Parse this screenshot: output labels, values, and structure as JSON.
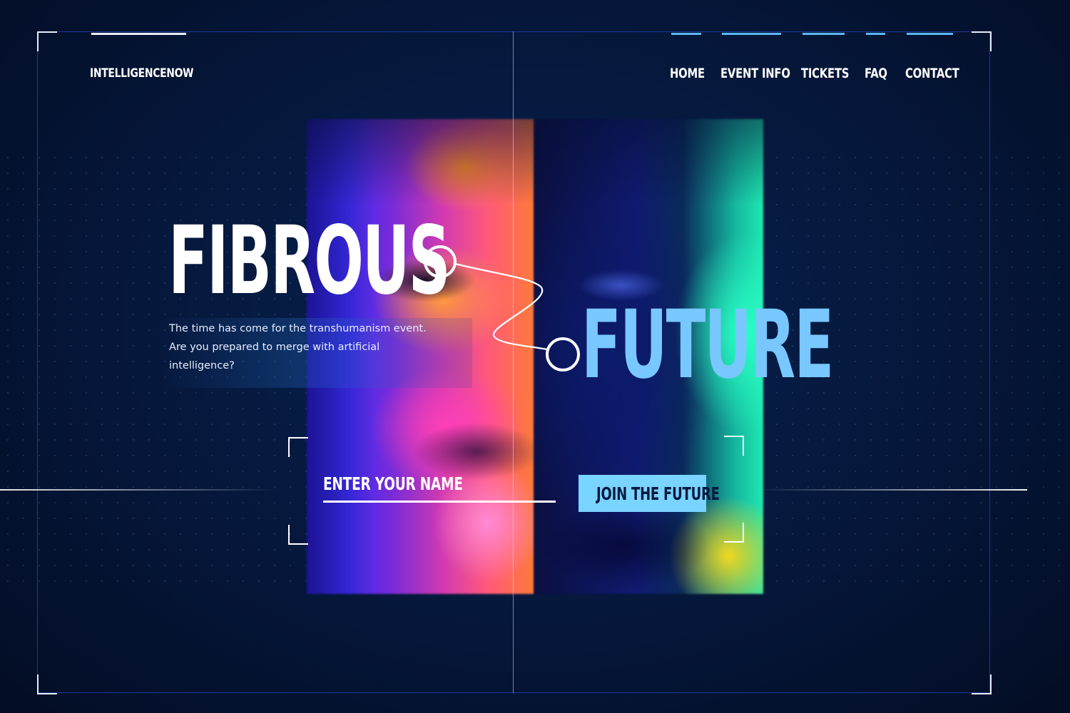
{
  "header": {
    "brand": "INTELLIGENCENOW",
    "nav": [
      {
        "label": "HOME"
      },
      {
        "label": "EVENT INFO"
      },
      {
        "label": "TICKETS"
      },
      {
        "label": "FAQ"
      },
      {
        "label": "CONTACT"
      }
    ]
  },
  "hero": {
    "title_word_1": "FIBROUS",
    "title_word_2": "FUTURE",
    "tagline": "The time has come for the transhumanism event. Are you prepared to merge with artificial intelligence?"
  },
  "form": {
    "name_placeholder": "ENTER YOUR NAME",
    "submit_label": "JOIN THE FUTURE"
  },
  "colors": {
    "background": "#041230",
    "accent": "#79d4ff",
    "future_text": "#79c7ff",
    "frame": "#1a3a9a"
  },
  "icons": {
    "connector": "circle-link-connector-icon"
  }
}
